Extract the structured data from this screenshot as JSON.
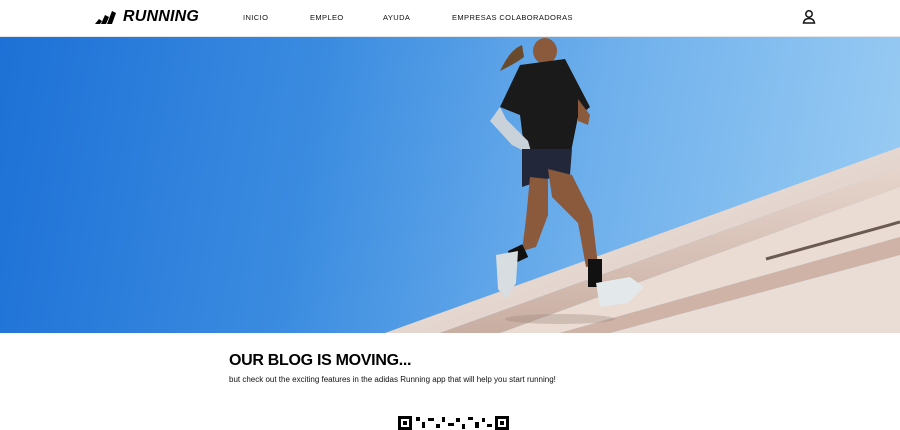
{
  "header": {
    "logo_text": "RUNNING",
    "nav": [
      {
        "label": "INICIO"
      },
      {
        "label": "EMPLEO"
      },
      {
        "label": "AYUDA"
      },
      {
        "label": "EMPRESAS COLABORADORAS"
      }
    ],
    "account_icon": "user-icon"
  },
  "hero": {
    "sky_color": "#3b8ce0",
    "stairs_color": "#e8ddd6"
  },
  "blog": {
    "title": "OUR BLOG IS MOVING...",
    "subtitle": "but check out the exciting features in the adidas Running app that will help you start running!"
  },
  "qr": {
    "icon": "qr-code-icon"
  }
}
